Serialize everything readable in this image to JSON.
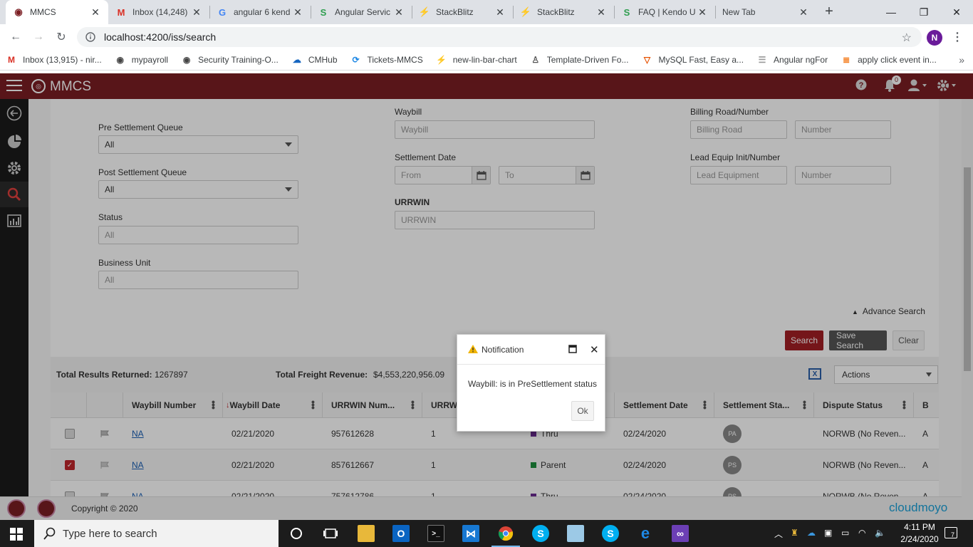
{
  "browser": {
    "tabs": [
      {
        "title": "MMCS",
        "icon": "mmcs-favicon",
        "active": true
      },
      {
        "title": "Inbox (14,248)",
        "icon": "gmail-icon"
      },
      {
        "title": "angular 6 kend",
        "icon": "google-icon"
      },
      {
        "title": "Angular Servic",
        "icon": "angular-service-icon"
      },
      {
        "title": "StackBlitz",
        "icon": "stackblitz-icon"
      },
      {
        "title": "StackBlitz",
        "icon": "stackblitz-icon"
      },
      {
        "title": "FAQ | Kendo U",
        "icon": "kendo-icon"
      },
      {
        "title": "New Tab",
        "icon": ""
      }
    ],
    "url": "localhost:4200/iss/search",
    "profile_initial": "N",
    "bookmarks": [
      {
        "label": "Inbox (13,915) - nir...",
        "icon": "gmail-icon"
      },
      {
        "label": "mypayroll",
        "icon": "globe-icon"
      },
      {
        "label": "Security Training-O...",
        "icon": "globe-icon"
      },
      {
        "label": "CMHub",
        "icon": "cmhub-icon"
      },
      {
        "label": "Tickets-MMCS",
        "icon": "tickets-icon"
      },
      {
        "label": "new-lin-bar-chart",
        "icon": "stackblitz-icon"
      },
      {
        "label": "Template-Driven Fo...",
        "icon": "template-icon"
      },
      {
        "label": "MySQL Fast, Easy a...",
        "icon": "mysql-icon"
      },
      {
        "label": "Angular ngFor",
        "icon": "document-icon"
      },
      {
        "label": "apply click event in...",
        "icon": "stackoverflow-icon"
      }
    ]
  },
  "app": {
    "title": "MMCS",
    "notification_count": "0",
    "colors": {
      "brand": "#7b1e23",
      "primary_button": "#a31f25"
    }
  },
  "form": {
    "pre_settlement_queue": {
      "label": "Pre Settlement Queue",
      "value": "All"
    },
    "post_settlement_queue": {
      "label": "Post Settlement Queue",
      "value": "All"
    },
    "status": {
      "label": "Status",
      "placeholder": "All"
    },
    "business_unit": {
      "label": "Business Unit",
      "placeholder": "All"
    },
    "waybill": {
      "label": "Waybill",
      "placeholder": "Waybill"
    },
    "settlement_date": {
      "label": "Settlement Date",
      "from_placeholder": "From",
      "to_placeholder": "To"
    },
    "urrwin": {
      "label": "URRWIN",
      "placeholder": "URRWIN"
    },
    "billing_road": {
      "label": "Billing Road/Number",
      "road_placeholder": "Billing Road",
      "number_placeholder": "Number"
    },
    "lead_equip": {
      "label": "Lead Equip Init/Number",
      "equip_placeholder": "Lead Equipment",
      "number_placeholder": "Number"
    },
    "advance_search": "Advance Search",
    "buttons": {
      "search": "Search",
      "save_search": "Save Search",
      "clear": "Clear"
    }
  },
  "summary": {
    "total_results_label": "Total Results Returned:",
    "total_results_value": "1267897",
    "total_revenue_label": "Total Freight Revenue:",
    "total_revenue_value": "$4,553,220,956.09",
    "actions_label": "Actions"
  },
  "grid": {
    "columns": [
      "Waybill Number",
      "Waybill Date",
      "URRWIN Num...",
      "URRW",
      "Settlement Date",
      "Settlement Sta...",
      "Dispute Status",
      "B"
    ],
    "rows": [
      {
        "checked": false,
        "waybill": "NA",
        "date": "02/21/2020",
        "urrwin": "957612628",
        "urrw": "1",
        "type": "Thru",
        "type_color": "#6a2c91",
        "settlement_date": "02/24/2020",
        "settlement_status": "PA",
        "dispute": "NORWB (No Reven...",
        "b": "A"
      },
      {
        "checked": true,
        "waybill": "NA",
        "date": "02/21/2020",
        "urrwin": "857612667",
        "urrw": "1",
        "type": "Parent",
        "type_color": "#1e8e3e",
        "settlement_date": "02/24/2020",
        "settlement_status": "PS",
        "dispute": "NORWB (No Reven...",
        "b": "A"
      },
      {
        "checked": false,
        "waybill": "NA",
        "date": "02/21/2020",
        "urrwin": "757612786",
        "urrw": "1",
        "type": "Thru",
        "type_color": "#6a2c91",
        "settlement_date": "02/24/2020",
        "settlement_status": "PS",
        "dispute": "NORWB (No Reven...",
        "b": "A"
      }
    ]
  },
  "footer": {
    "copyright": "Copyright © 2020",
    "brand": "cloudmoyo"
  },
  "modal": {
    "title": "Notification",
    "message": "Waybill: is in PreSettlement status",
    "ok_label": "Ok"
  },
  "taskbar": {
    "search_placeholder": "Type here to search",
    "time": "4:11 PM",
    "date": "2/24/2020",
    "notification_count": "7"
  }
}
